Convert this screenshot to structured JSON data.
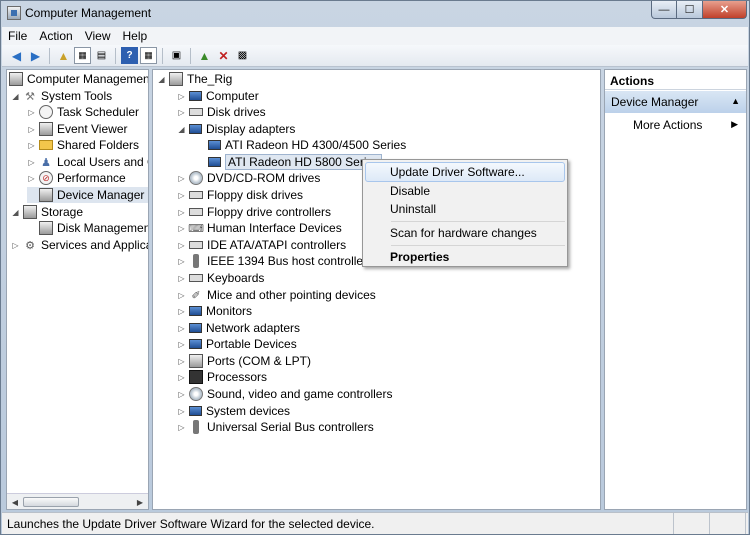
{
  "window": {
    "title": "Computer Management",
    "min": "—",
    "max": "☐",
    "close": "✕"
  },
  "menu": [
    "File",
    "Action",
    "View",
    "Help"
  ],
  "toolbar": [
    "back-icon",
    "forward-icon",
    "up-folder-icon",
    "console-tree-icon",
    "properties-icon",
    "help-icon",
    "show-hide-action-pane-icon",
    "scan-hardware-icon",
    "update-driver-icon",
    "uninstall-icon",
    "disable-icon"
  ],
  "left_tree": {
    "root": "Computer Management",
    "system_tools": "System Tools",
    "items": [
      "Task Scheduler",
      "Event Viewer",
      "Shared Folders",
      "Local Users and Groups",
      "Performance",
      "Device Manager"
    ],
    "storage": "Storage",
    "disk_management": "Disk Management",
    "services": "Services and Applications"
  },
  "device_tree": {
    "root": "The_Rig",
    "display_adapters": "Display adapters",
    "adapters": [
      "ATI Radeon HD 4300/4500 Series",
      "ATI Radeon HD 5800 Series"
    ],
    "categories_before": [
      "Computer",
      "Disk drives"
    ],
    "categories_after": [
      "DVD/CD-ROM drives",
      "Floppy disk drives",
      "Floppy drive controllers",
      "Human Interface Devices",
      "IDE ATA/ATAPI controllers",
      "IEEE 1394 Bus host controllers",
      "Keyboards",
      "Mice and other pointing devices",
      "Monitors",
      "Network adapters",
      "Portable Devices",
      "Ports (COM & LPT)",
      "Processors",
      "Sound, video and game controllers",
      "System devices",
      "Universal Serial Bus controllers"
    ]
  },
  "context_menu": {
    "update": "Update Driver Software...",
    "disable": "Disable",
    "uninstall": "Uninstall",
    "scan": "Scan for hardware changes",
    "properties": "Properties"
  },
  "actions": {
    "header": "Actions",
    "section": "Device Manager",
    "more": "More Actions"
  },
  "status": "Launches the Update Driver Software Wizard for the selected device."
}
